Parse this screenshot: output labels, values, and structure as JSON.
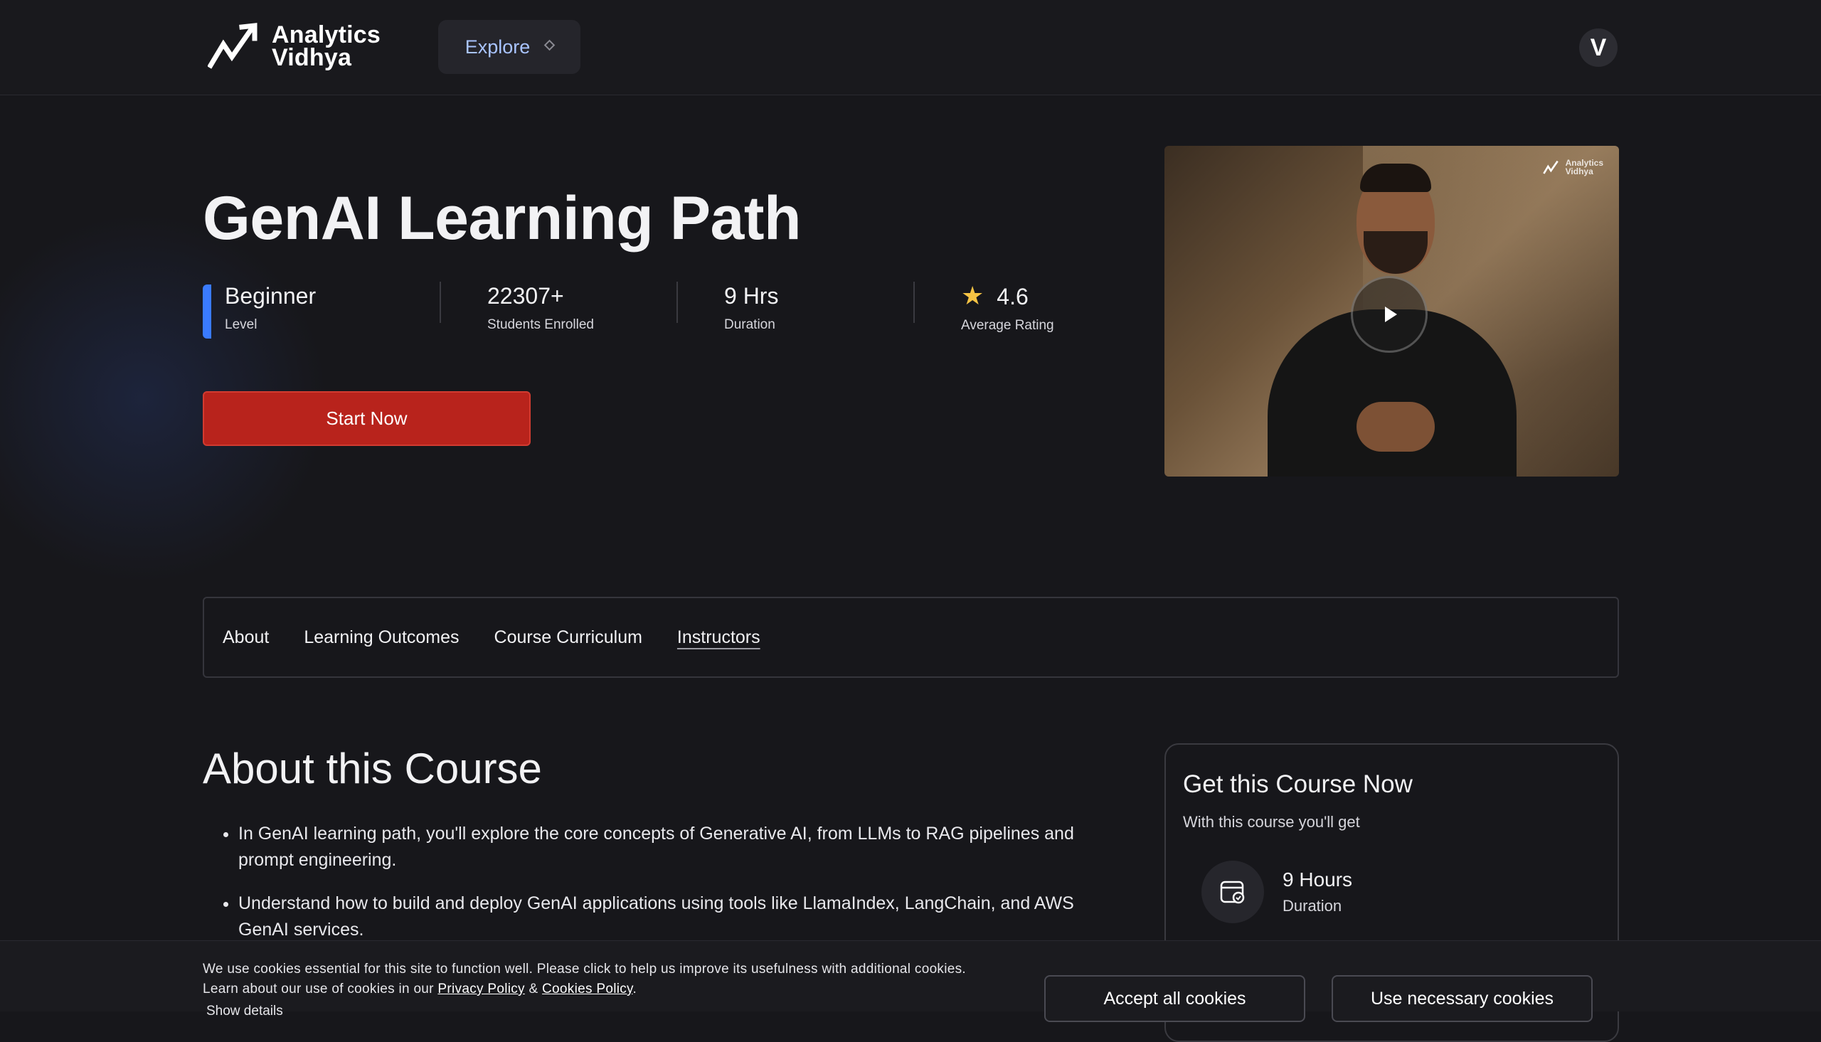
{
  "header": {
    "logo_line1": "Analytics",
    "logo_line2": "Vidhya",
    "explore_label": "Explore",
    "avatar_initial": "V"
  },
  "hero": {
    "title": "GenAI Learning Path",
    "stats": [
      {
        "value": "Beginner",
        "label": "Level"
      },
      {
        "value": "22307+",
        "label": "Students Enrolled"
      },
      {
        "value": "9 Hrs",
        "label": "Duration"
      },
      {
        "value": "4.6",
        "label": "Average Rating"
      }
    ],
    "start_label": "Start Now",
    "video_watermark_line1": "Analytics",
    "video_watermark_line2": "Vidhya"
  },
  "tabs": [
    {
      "label": "About"
    },
    {
      "label": "Learning Outcomes"
    },
    {
      "label": "Course Curriculum"
    },
    {
      "label": "Instructors"
    }
  ],
  "about": {
    "title": "About this Course",
    "bullets": [
      "In GenAI learning path, you'll explore the core concepts of Generative AI, from LLMs to RAG pipelines and prompt engineering.",
      "Understand how to build and deploy GenAI applications using tools like LlamaIndex, LangChain, and AWS GenAI services."
    ]
  },
  "card": {
    "title": "Get this Course Now",
    "subtitle": "With this course you'll get",
    "feature_value": "9 Hours",
    "feature_label": "Duration"
  },
  "cookie": {
    "text_line1": "We use cookies essential for this site to function well. Please click to help us improve its usefulness with additional cookies.",
    "text_line2_prefix": "Learn about our use of cookies in our",
    "privacy_link": "Privacy Policy",
    "amp": "&",
    "cookies_link": "Cookies Policy",
    "period": ".",
    "show_details": "Show details",
    "accept_label": "Accept all cookies",
    "necessary_label": "Use necessary cookies"
  },
  "colors": {
    "background": "#17171b",
    "accent_red": "#b8231c",
    "level_bar": "#3a7bff",
    "star": "#f6c344",
    "explore_text": "#a9c4ff"
  }
}
